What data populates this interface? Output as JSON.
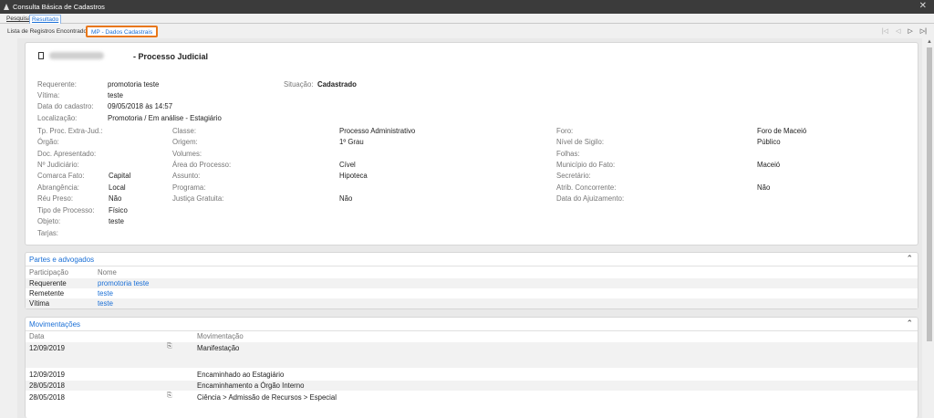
{
  "window": {
    "title": "Consulta Básica de Cadastros",
    "close": "✕"
  },
  "tabs": [
    "Pesquisa",
    "Resultado"
  ],
  "breadcrumb": {
    "list": "Lista de Registros Encontrados",
    "current": "MP - Dados Cadastrais"
  },
  "nav": {
    "first": "|◁",
    "prev": "◁",
    "next": "▷",
    "last": "▷|"
  },
  "process": {
    "title": "- Processo Judicial",
    "fields": {
      "requerente": {
        "label": "Requerente:",
        "value": "promotoria teste"
      },
      "vitima": {
        "label": "Vítima:",
        "value": "teste"
      },
      "data_cadastro": {
        "label": "Data do cadastro:",
        "value": "09/05/2018 às 14:57"
      },
      "localizacao": {
        "label": "Localização:",
        "value": "Promotoria / Em análise - Estagiário"
      },
      "situacao": {
        "label": "Situação:",
        "value": "Cadastrado"
      },
      "tp_proc": {
        "label": "Tp. Proc. Extra-Jud.:",
        "value": ""
      },
      "orgao": {
        "label": "Órgão:",
        "value": ""
      },
      "doc_apresentado": {
        "label": "Doc. Apresentado:",
        "value": ""
      },
      "n_judiciario": {
        "label": "Nº Judiciário:",
        "value": ""
      },
      "comarca_fato": {
        "label": "Comarca Fato:",
        "value": "Capital"
      },
      "abrangencia": {
        "label": "Abrangência:",
        "value": "Local"
      },
      "reu_preso": {
        "label": "Réu Preso:",
        "value": "Não"
      },
      "tipo_processo": {
        "label": "Tipo de Processo:",
        "value": "Físico"
      },
      "objeto": {
        "label": "Objeto:",
        "value": "teste"
      },
      "tarjas": {
        "label": "Tarjas:",
        "value": ""
      },
      "classe": {
        "label": "Classe:",
        "value": "Processo Administrativo"
      },
      "origem": {
        "label": "Origem:",
        "value": "1º Grau"
      },
      "volumes": {
        "label": "Volumes:",
        "value": ""
      },
      "area": {
        "label": "Área do Processo:",
        "value": "Cível"
      },
      "assunto": {
        "label": "Assunto:",
        "value": "Hipoteca"
      },
      "programa": {
        "label": "Programa:",
        "value": ""
      },
      "justica_gratuita": {
        "label": "Justiça Gratuita:",
        "value": "Não"
      },
      "foro": {
        "label": "Foro:",
        "value": "Foro de Maceió"
      },
      "nivel_sigilo": {
        "label": "Nível de Sigilo:",
        "value": "Público"
      },
      "folhas": {
        "label": "Folhas:",
        "value": ""
      },
      "municipio_fato": {
        "label": "Município do Fato:",
        "value": "Maceió"
      },
      "secretario": {
        "label": "Secretário:",
        "value": ""
      },
      "atrib_concorrente": {
        "label": "Atrib. Concorrente:",
        "value": "Não"
      },
      "data_ajuizamento": {
        "label": "Data do Ajuizamento:",
        "value": ""
      }
    }
  },
  "partes": {
    "title": "Partes e advogados",
    "headers": [
      "Participação",
      "Nome"
    ],
    "rows": [
      [
        "Requerente",
        "promotoria teste"
      ],
      [
        "Remetente",
        "teste"
      ],
      [
        "Vítima",
        "teste"
      ]
    ]
  },
  "movimentacoes": {
    "title": "Movimentações",
    "headers": [
      "Data",
      "Movimentação"
    ],
    "rows": [
      [
        "12/09/2019",
        "Manifestação"
      ],
      [
        "12/09/2019",
        "Encaminhado ao Estagiário"
      ],
      [
        "28/05/2018",
        "Encaminhamento a Órgão Interno"
      ],
      [
        "28/05/2018",
        "Ciência > Admissão de Recursos > Especial"
      ]
    ]
  },
  "colors": {
    "accent": "#1a6fd6",
    "highlight_border": "#e8771a",
    "titlebar": "#3b3b3b"
  }
}
